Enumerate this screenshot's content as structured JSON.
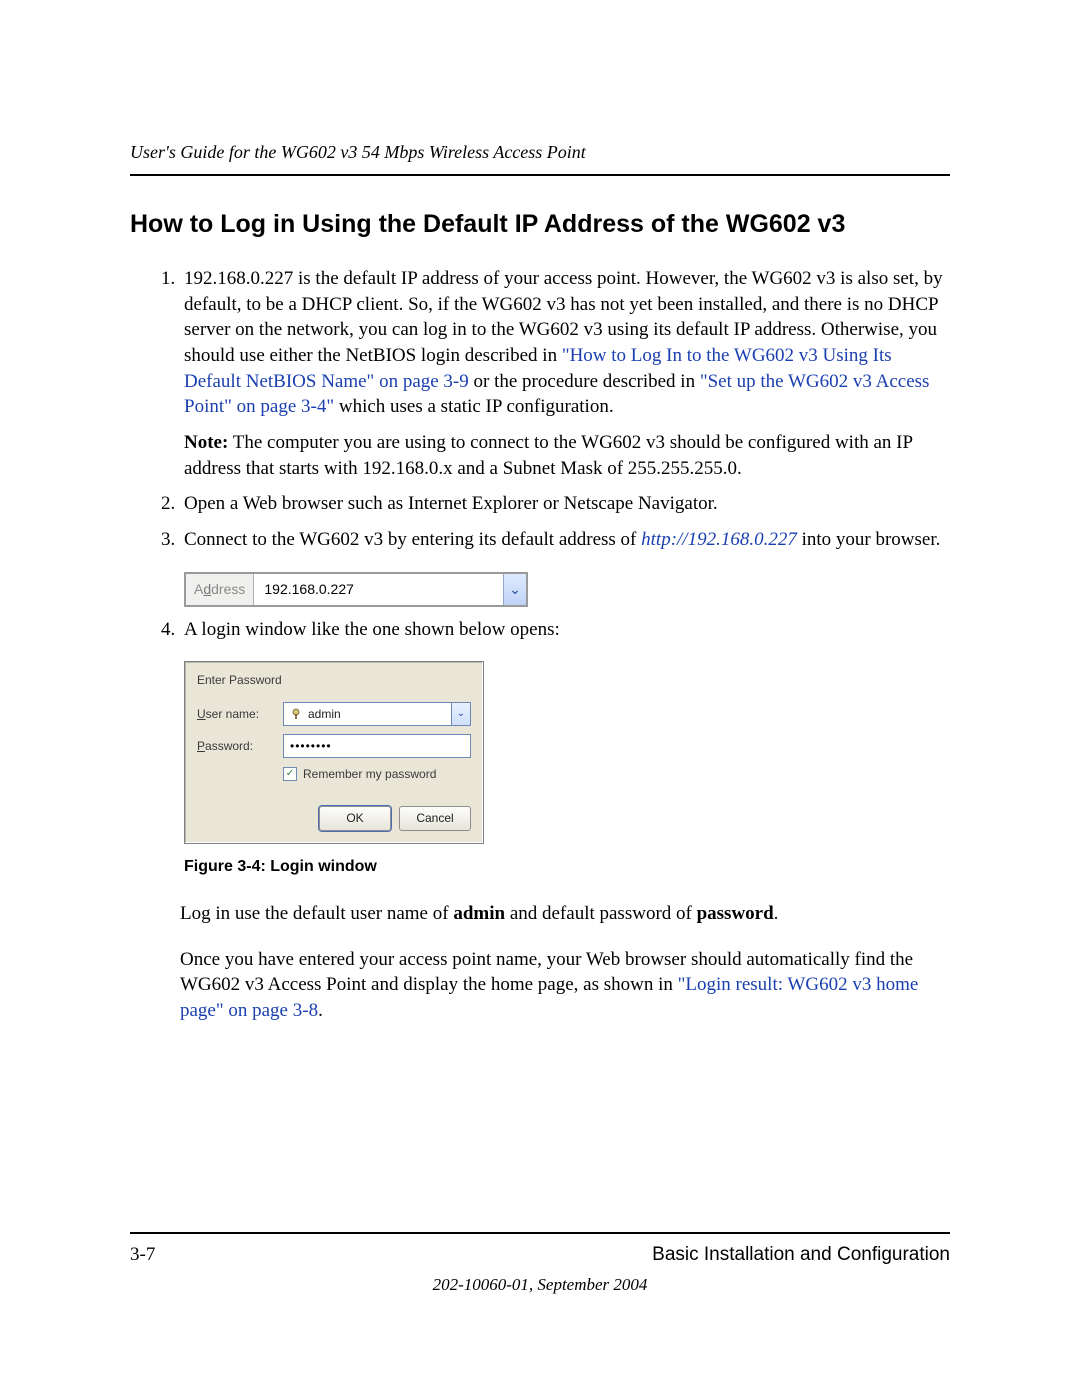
{
  "header": {
    "running": "User's Guide for the WG602 v3 54 Mbps Wireless Access Point"
  },
  "heading": "How to Log in Using the Default IP Address of the WG602 v3",
  "list": {
    "item1": {
      "t1": "192.168.0.227 is the default IP address of your access point. However, the WG602 v3 is also set, by default, to be a DHCP client. So, if the WG602 v3 has not yet been installed, and there is no DHCP server on the network, you can log in to the WG602 v3 using its default IP address. Otherwise, you should use either the NetBIOS login described in ",
      "link1": "\"How to Log In to the WG602 v3 Using Its Default NetBIOS Name\" on page 3-9",
      "t2": " or the procedure described in ",
      "link2": "\"Set up the WG602 v3 Access Point\" on page 3-4\"",
      "t3": " which uses a static IP configuration.",
      "note_label": "Note:",
      "note_text": " The computer you are using to connect to the WG602 v3 should be configured with an IP address that starts with 192.168.0.x and a Subnet Mask of 255.255.255.0."
    },
    "item2": "Open a Web browser such as Internet Explorer or Netscape Navigator.",
    "item3": {
      "t1": "Connect to the WG602 v3 by entering its default address of ",
      "url": "http://192.168.0.227",
      "t2": " into your browser."
    },
    "item4": "A login window like the one shown below opens:"
  },
  "address_bar": {
    "label_pre": "A",
    "label_u": "d",
    "label_post": "dress",
    "value": "192.168.0.227",
    "drop_glyph": "⌄"
  },
  "login": {
    "title": "Enter Password",
    "user_label_u": "U",
    "user_label_rest": "ser name:",
    "user_value": "admin",
    "pw_label_u": "P",
    "pw_label_rest": "assword:",
    "pw_value": "••••••••",
    "remember_u": "R",
    "remember_rest": "emember my password",
    "chk_glyph": "✓",
    "ok": "OK",
    "cancel": "Cancel",
    "drop_glyph": "⌄"
  },
  "figure_caption": "Figure 3-4: Login window",
  "para_login": {
    "t1": "Log in use the default user name of ",
    "b1": "admin",
    "t2": " and default password of ",
    "b2": "password",
    "t3": "."
  },
  "para_after": {
    "t1": "Once you have entered your access point name, your Web browser should automatically find the WG602 v3 Access Point and display the home page, as shown in ",
    "link": "\"Login result: WG602 v3 home page\" on page 3-8",
    "t2": "."
  },
  "footer": {
    "page": "3-7",
    "section": "Basic Installation and Configuration",
    "docinfo": "202-10060-01, September 2004"
  }
}
